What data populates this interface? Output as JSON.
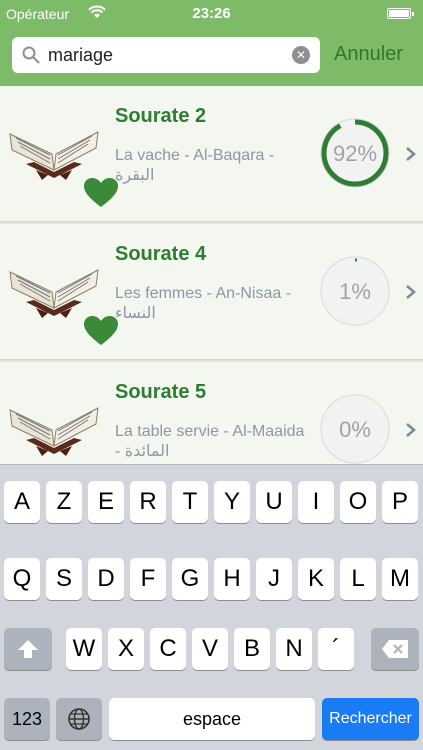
{
  "status_bar": {
    "carrier": "Opérateur",
    "time": "23:26"
  },
  "search": {
    "value": "mariage",
    "cancel_label": "Annuler"
  },
  "rows": [
    {
      "title": "Sourate 2",
      "subtitle": "La vache - Al-Baqara - البقرة",
      "progress": "92%",
      "progress_value": 0.92,
      "favorite": true
    },
    {
      "title": "Sourate 4",
      "subtitle": "Les femmes - An-Nisaa - النساء",
      "progress": "1%",
      "progress_value": 0.01,
      "favorite": true
    },
    {
      "title": "Sourate 5",
      "subtitle": "La table servie - Al-Maaida - المائدة",
      "progress": "0%",
      "progress_value": 0.0,
      "favorite": false
    }
  ],
  "keyboard": {
    "row1": [
      "A",
      "Z",
      "E",
      "R",
      "T",
      "Y",
      "U",
      "I",
      "O",
      "P"
    ],
    "row2": [
      "Q",
      "S",
      "D",
      "F",
      "G",
      "H",
      "J",
      "K",
      "L",
      "M"
    ],
    "row3": [
      "W",
      "X",
      "C",
      "V",
      "B",
      "N",
      "´"
    ],
    "numbers_label": "123",
    "space_label": "espace",
    "search_label": "Rechercher"
  },
  "colors": {
    "accent_green": "#7dbb69",
    "title_green": "#2e7d32",
    "progress_green": "#2e7d32",
    "key_blue": "#1a7cf5"
  }
}
